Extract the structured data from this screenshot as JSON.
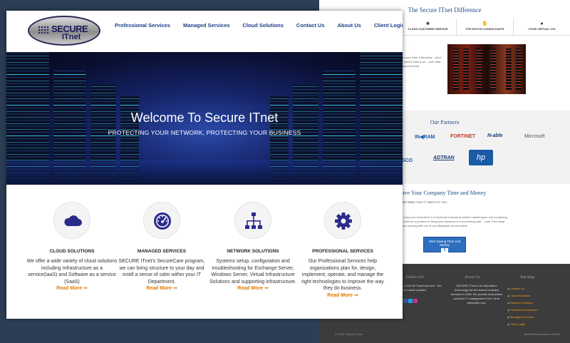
{
  "front": {
    "logo": {
      "line1": "SECURE",
      "line2": "ITnet"
    },
    "nav": [
      {
        "label": "Professional Services"
      },
      {
        "label": "Managed Services"
      },
      {
        "label": "Cloud Solutions"
      },
      {
        "label": "Contact Us"
      },
      {
        "label": "About Us"
      },
      {
        "label": "Client Login"
      }
    ],
    "hero": {
      "title": "Welcome To Secure ITnet",
      "subtitle": "PROTECTING YOUR NETWORK, PROTECTING YOUR BUSINESS"
    },
    "services": [
      {
        "icon": "cloud-icon",
        "title": "CLOUD SOLUTIONS",
        "desc": "We offer a wide variety of cloud solutions including Infrastructure as a service(IaaS) and Software as a service (SaaS)",
        "more": "Read More ➞"
      },
      {
        "icon": "gauge-icon",
        "title": "MANAGED SERVICES",
        "desc": "SECURE ITnet's SecureCare program, we can bring structure to your day and instill a sense of calm within your IT Department.",
        "more": "Read More ➞"
      },
      {
        "icon": "network-icon",
        "title": "NETWORK SOLUTIONS",
        "desc": "Systems setup, configuration and troubleshooting for Exchange Server, Windows Server, Virtual Infrastructure Solutions and supporting infrastructure.",
        "more": "Read More ➞"
      },
      {
        "icon": "gear-icon",
        "title": "PROFESSIONAL SERVICES",
        "desc": "Our Professional Services help organizations plan for, design, implement, operate, and manage the right technologies to improve the way they do business.",
        "more": "Read More ➞"
      }
    ],
    "colors": {
      "nav": "#1f3f8c",
      "accent": "#e07b00",
      "icon": "#2b2b8c"
    }
  },
  "back": {
    "difference_title": "The Secure ITnet Difference",
    "tabs": [
      {
        "icon": "star-icon",
        "label": "CLASS CUSTOMER SERVICE"
      },
      {
        "icon": "handshake-icon",
        "label": "TOP NOTCH CONSULTANTS"
      },
      {
        "icon": "user-icon",
        "label": "YOUR VIRTUAL CIO"
      }
    ],
    "difference_text": "...for your data. Partnering ...all of our client's data is as ...your data is stored behind",
    "partners_title": "Our Partners",
    "partners": [
      "IN◀RAM",
      "FORTINET",
      "N-able",
      "Microsoft",
      "ISCO",
      "ADTRAN",
      "hp"
    ],
    "save_title": "ave Your Company Time and Money",
    "save_subtitle": "We Make Your IT Work For You.",
    "save_text": "...keep your downtime to a minimum through proactive maintenance and monitoring. ...wait for a problem to bring your business to a screeching halt. ...cure ITnet keep you running with one of our affordable service plans.",
    "save_button": "Start Saving Time And Money",
    "follow_title": "Follow Us!",
    "follow_text": "...s Out On Facebook and ...tter For Latest Updates",
    "about_title": "About Us",
    "about_text": "SECURE ITnet is an information technology service based company founded in 1996. We provide businesses proactive IT management 24x7 at an affordable cost.",
    "sitemap_title": "Site Map",
    "sitemap": [
      "Contact Us",
      "Cloud Solutions",
      "Network Solutions",
      "Professional Services",
      "Managed Services",
      "Client Login"
    ],
    "copyright": "© 2015, Secure ITnet",
    "theme": "WordPress Business Theme"
  }
}
